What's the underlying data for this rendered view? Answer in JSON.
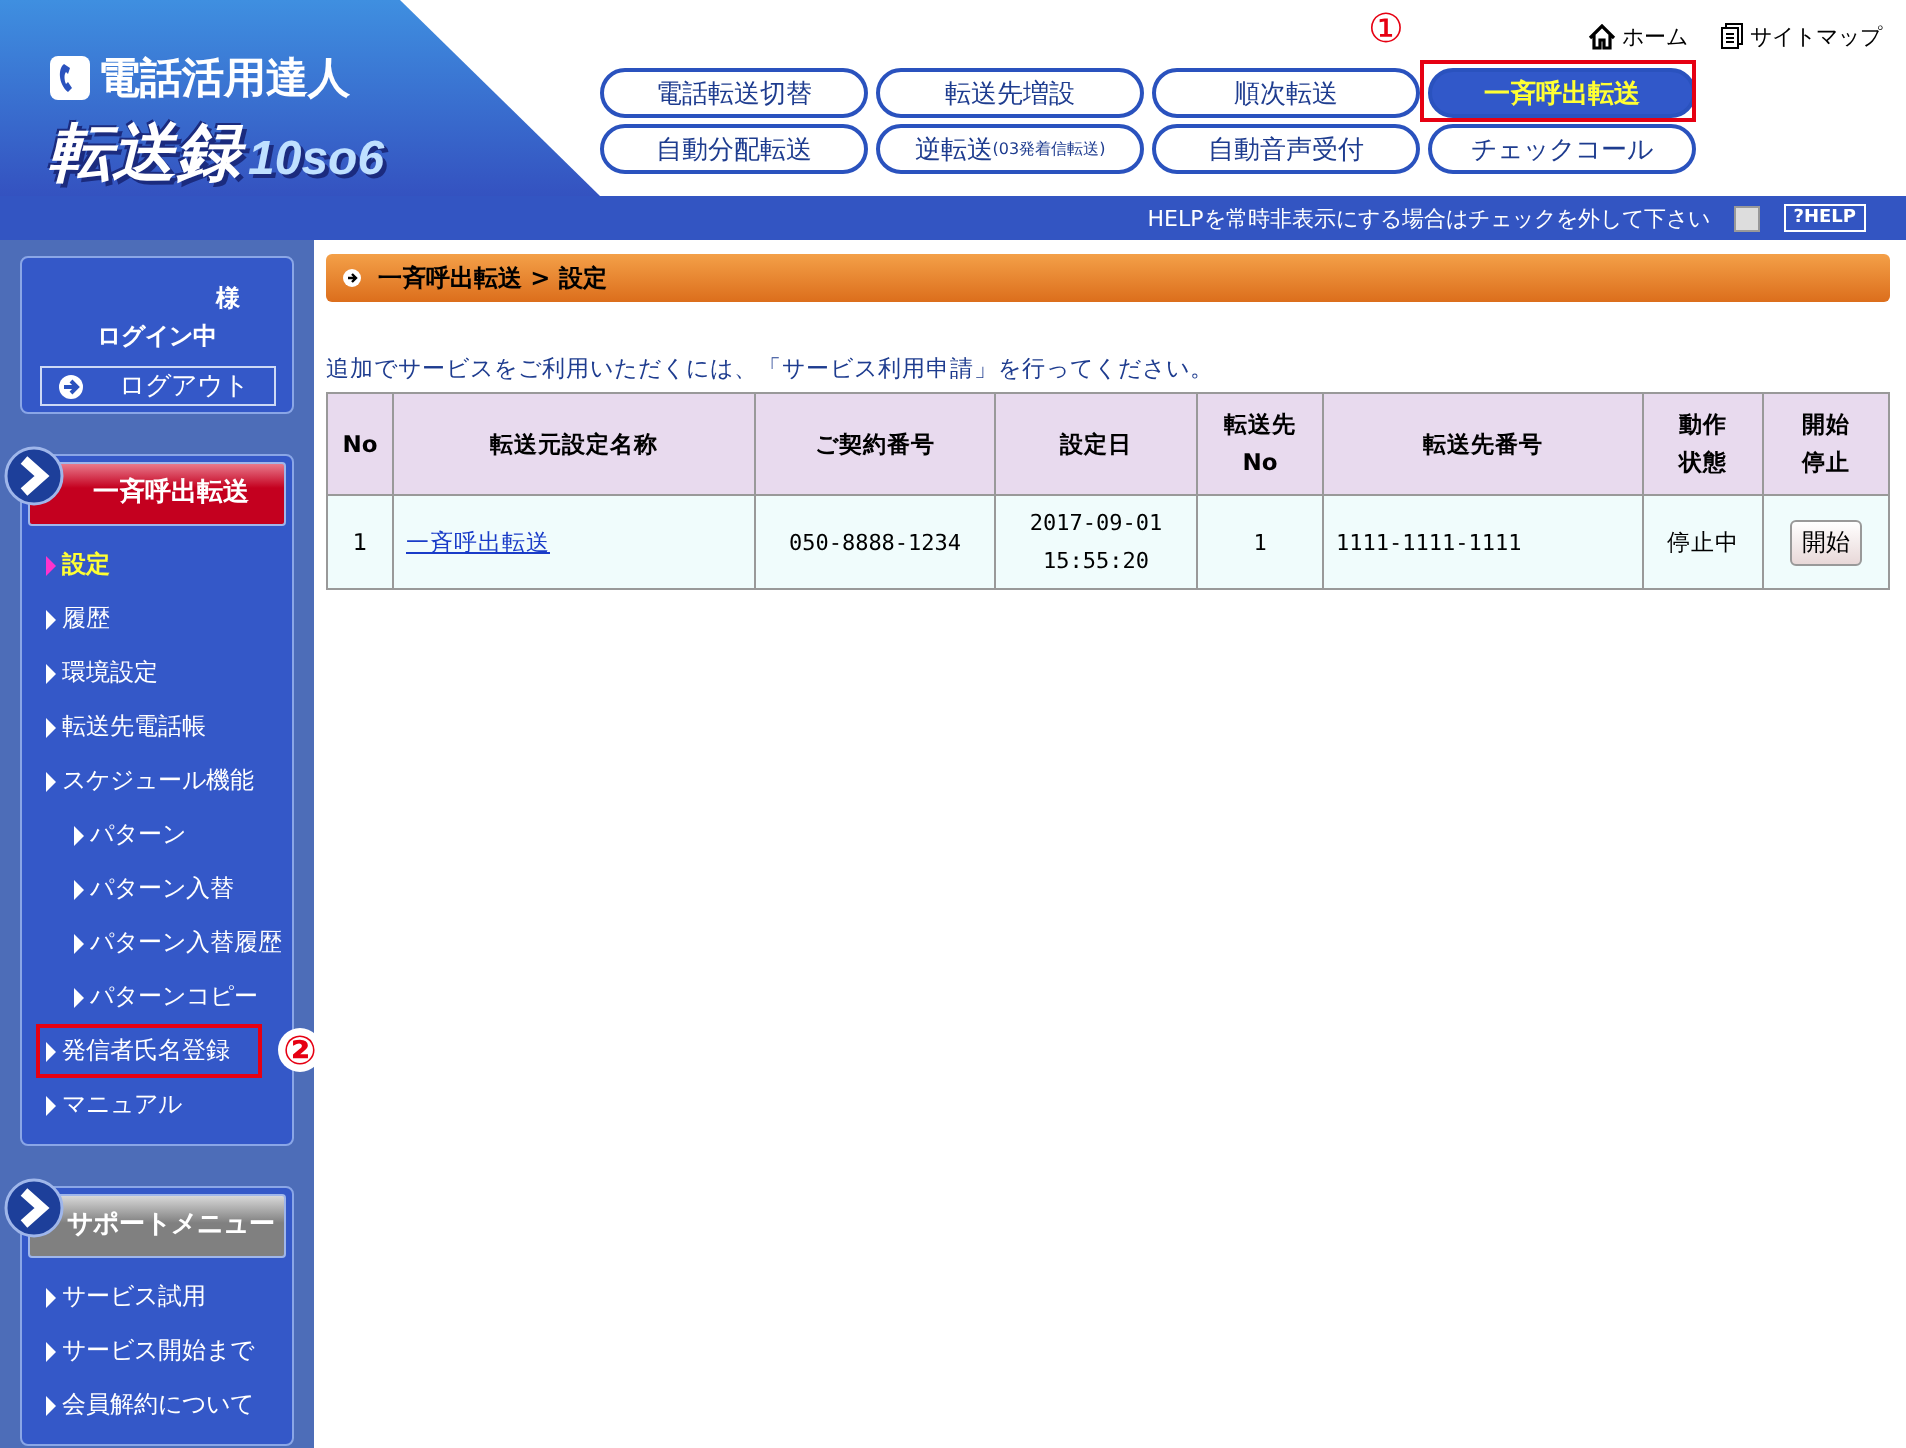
{
  "logo": {
    "tagline": "電話活用達人",
    "title": "転送録",
    "version": "10so6"
  },
  "top_links": [
    {
      "label": "ホーム",
      "kind": "home"
    },
    {
      "label": "サイトマップ",
      "kind": "sitemap"
    }
  ],
  "nav_tabs": [
    {
      "label": "電話転送切替",
      "selected": false
    },
    {
      "label": "転送先増設",
      "selected": false
    },
    {
      "label": "順次転送",
      "selected": false
    },
    {
      "label": "一斉呼出転送",
      "selected": true,
      "annotation": "①"
    },
    {
      "label": "自動分配転送",
      "selected": false
    },
    {
      "label": "逆転送",
      "sub": "(03発着信転送)",
      "selected": false
    },
    {
      "label": "自動音声受付",
      "selected": false
    },
    {
      "label": "チェックコール",
      "selected": false
    }
  ],
  "help_bar": {
    "text": "HELPを常時非表示にする場合はチェックを外して下さい",
    "checked": false,
    "button": "?HELP"
  },
  "login": {
    "suffix": "様",
    "status": "ログイン中",
    "logout": "ログアウト"
  },
  "menus": [
    {
      "title": "一斉呼出転送",
      "kind": "active",
      "items": [
        {
          "label": "設定",
          "selected": true
        },
        {
          "label": "履歴",
          "selected": false
        },
        {
          "label": "環境設定",
          "selected": false
        },
        {
          "label": "転送先電話帳",
          "selected": false
        },
        {
          "label": "スケジュール機能",
          "selected": false,
          "children": [
            {
              "label": "パターン",
              "selected": false
            },
            {
              "label": "パターン入替",
              "selected": false
            },
            {
              "label": "パターン入替履歴",
              "selected": false
            },
            {
              "label": "パターンコピー",
              "selected": false
            }
          ]
        },
        {
          "label": "発信者氏名登録",
          "selected": false,
          "annotation": "②"
        },
        {
          "label": "マニュアル",
          "selected": false
        }
      ]
    },
    {
      "title": "サポートメニュー",
      "kind": "support",
      "items": [
        {
          "label": "サービス試用",
          "selected": false
        },
        {
          "label": "サービス開始まで",
          "selected": false
        },
        {
          "label": "会員解約について",
          "selected": false
        }
      ]
    }
  ],
  "breadcrumb": "一斉呼出転送 > 設定",
  "notice": "追加でサービスをご利用いただくには、「サービス利用申請」を行ってください。",
  "table": {
    "columns": [
      [
        "No"
      ],
      [
        "転送元設定名称"
      ],
      [
        "ご契約番号"
      ],
      [
        "設定日"
      ],
      [
        "転送先",
        "No"
      ],
      [
        "転送先番号"
      ],
      [
        "動作",
        "状態"
      ],
      [
        "開始",
        "停止"
      ]
    ],
    "rows": [
      {
        "no": "1",
        "name": "一斉呼出転送",
        "contract": "050-8888-1234",
        "date": "2017-09-01",
        "time": "15:55:20",
        "dest_no": "1",
        "dest_number": "1111-1111-1111",
        "status": "停止中",
        "action": "開始"
      }
    ]
  }
}
